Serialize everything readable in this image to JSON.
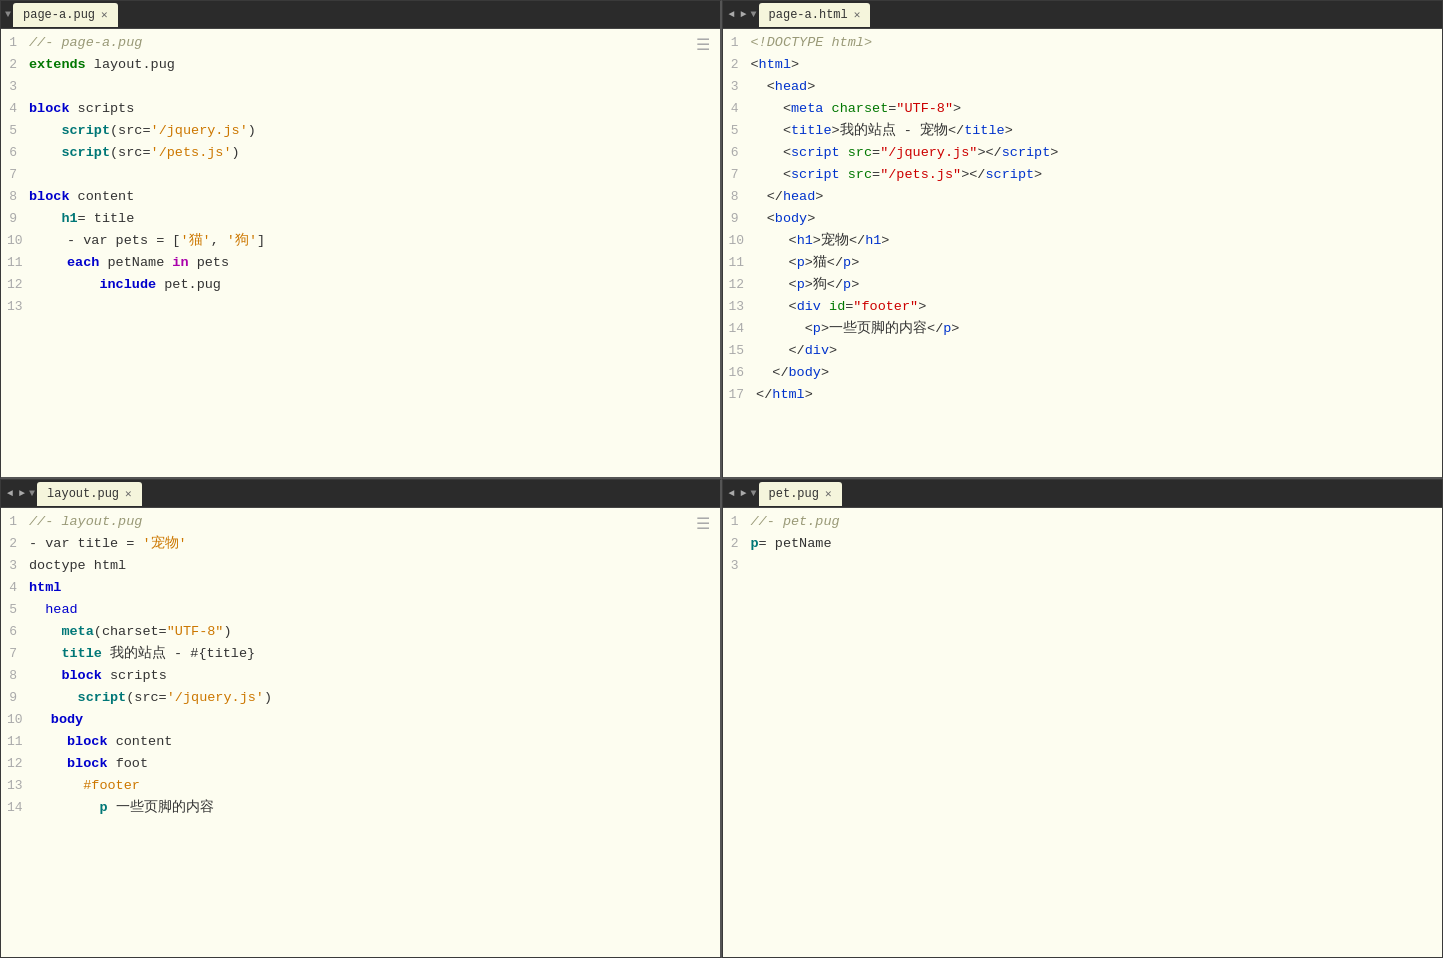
{
  "panes": {
    "top_left": {
      "tab_label": "page-a.pug",
      "lines": [
        {
          "num": 1,
          "tokens": [
            {
              "t": "//- page-a.pug",
              "c": "comment"
            }
          ]
        },
        {
          "num": 2,
          "tokens": [
            {
              "t": "extends",
              "c": "kw-green-bold"
            },
            {
              "t": " layout.pug",
              "c": "plain"
            }
          ]
        },
        {
          "num": 3,
          "tokens": []
        },
        {
          "num": 4,
          "tokens": [
            {
              "t": "block",
              "c": "kw-blue"
            },
            {
              "t": " scripts",
              "c": "plain"
            }
          ]
        },
        {
          "num": 5,
          "tokens": [
            {
              "t": "    ",
              "c": "plain"
            },
            {
              "t": "script",
              "c": "kw-teal-bold"
            },
            {
              "t": "(src=",
              "c": "plain"
            },
            {
              "t": "'/jquery.js'",
              "c": "str-orange"
            },
            {
              "t": ")",
              "c": "plain"
            }
          ]
        },
        {
          "num": 6,
          "tokens": [
            {
              "t": "    ",
              "c": "plain"
            },
            {
              "t": "script",
              "c": "kw-teal-bold"
            },
            {
              "t": "(src=",
              "c": "plain"
            },
            {
              "t": "'/pets.js'",
              "c": "str-orange"
            },
            {
              "t": ")",
              "c": "plain"
            }
          ]
        },
        {
          "num": 7,
          "tokens": []
        },
        {
          "num": 8,
          "tokens": [
            {
              "t": "block",
              "c": "kw-blue"
            },
            {
              "t": " content",
              "c": "plain"
            }
          ]
        },
        {
          "num": 9,
          "tokens": [
            {
              "t": "    ",
              "c": "plain"
            },
            {
              "t": "h1",
              "c": "kw-teal-bold"
            },
            {
              "t": "= title",
              "c": "plain"
            }
          ]
        },
        {
          "num": 10,
          "tokens": [
            {
              "t": "    ",
              "c": "plain"
            },
            {
              "t": "- var pets = [",
              "c": "plain"
            },
            {
              "t": "'猫'",
              "c": "str-orange"
            },
            {
              "t": ", ",
              "c": "plain"
            },
            {
              "t": "'狗'",
              "c": "str-orange"
            },
            {
              "t": "]",
              "c": "plain"
            }
          ]
        },
        {
          "num": 11,
          "tokens": [
            {
              "t": "    ",
              "c": "plain"
            },
            {
              "t": "each",
              "c": "kw-blue"
            },
            {
              "t": " petName ",
              "c": "plain"
            },
            {
              "t": "in",
              "c": "in-kw"
            },
            {
              "t": " pets",
              "c": "plain"
            }
          ]
        },
        {
          "num": 12,
          "tokens": [
            {
              "t": "        ",
              "c": "plain"
            },
            {
              "t": "include",
              "c": "kw-blue"
            },
            {
              "t": " pet.pug",
              "c": "plain"
            }
          ]
        },
        {
          "num": 13,
          "tokens": []
        }
      ]
    },
    "top_right": {
      "tab_label": "page-a.html",
      "lines": [
        {
          "num": 1,
          "tokens": [
            {
              "t": "<!DOCTYPE html>",
              "c": "comment"
            }
          ]
        },
        {
          "num": 2,
          "tokens": [
            {
              "t": "<",
              "c": "plain"
            },
            {
              "t": "html",
              "c": "tag-blue"
            },
            {
              "t": ">",
              "c": "plain"
            }
          ]
        },
        {
          "num": 3,
          "tokens": [
            {
              "t": "  <",
              "c": "plain"
            },
            {
              "t": "head",
              "c": "tag-blue"
            },
            {
              "t": ">",
              "c": "plain"
            }
          ]
        },
        {
          "num": 4,
          "tokens": [
            {
              "t": "    <",
              "c": "plain"
            },
            {
              "t": "meta",
              "c": "tag-blue"
            },
            {
              "t": " ",
              "c": "plain"
            },
            {
              "t": "charset",
              "c": "attr-green"
            },
            {
              "t": "=",
              "c": "plain"
            },
            {
              "t": "\"UTF-8\"",
              "c": "attr-val"
            },
            {
              "t": ">",
              "c": "plain"
            }
          ]
        },
        {
          "num": 5,
          "tokens": [
            {
              "t": "    <",
              "c": "plain"
            },
            {
              "t": "title",
              "c": "tag-blue"
            },
            {
              "t": ">我的站点 - 宠物</",
              "c": "plain"
            },
            {
              "t": "title",
              "c": "tag-blue"
            },
            {
              "t": ">",
              "c": "plain"
            }
          ]
        },
        {
          "num": 6,
          "tokens": [
            {
              "t": "    <",
              "c": "plain"
            },
            {
              "t": "script",
              "c": "tag-blue"
            },
            {
              "t": " ",
              "c": "plain"
            },
            {
              "t": "src",
              "c": "attr-green"
            },
            {
              "t": "=",
              "c": "plain"
            },
            {
              "t": "\"/jquery.js\"",
              "c": "attr-val"
            },
            {
              "t": "></",
              "c": "plain"
            },
            {
              "t": "script",
              "c": "tag-blue"
            },
            {
              "t": ">",
              "c": "plain"
            }
          ]
        },
        {
          "num": 7,
          "tokens": [
            {
              "t": "    <",
              "c": "plain"
            },
            {
              "t": "script",
              "c": "tag-blue"
            },
            {
              "t": " ",
              "c": "plain"
            },
            {
              "t": "src",
              "c": "attr-green"
            },
            {
              "t": "=",
              "c": "plain"
            },
            {
              "t": "\"/pets.js\"",
              "c": "attr-val"
            },
            {
              "t": "></",
              "c": "plain"
            },
            {
              "t": "script",
              "c": "tag-blue"
            },
            {
              "t": ">",
              "c": "plain"
            }
          ]
        },
        {
          "num": 8,
          "tokens": [
            {
              "t": "  </",
              "c": "plain"
            },
            {
              "t": "head",
              "c": "tag-blue"
            },
            {
              "t": ">",
              "c": "plain"
            }
          ]
        },
        {
          "num": 9,
          "tokens": [
            {
              "t": "  <",
              "c": "plain"
            },
            {
              "t": "body",
              "c": "tag-blue"
            },
            {
              "t": ">",
              "c": "plain"
            }
          ]
        },
        {
          "num": 10,
          "tokens": [
            {
              "t": "    <",
              "c": "plain"
            },
            {
              "t": "h1",
              "c": "tag-blue"
            },
            {
              "t": ">宠物</",
              "c": "plain"
            },
            {
              "t": "h1",
              "c": "tag-blue"
            },
            {
              "t": ">",
              "c": "plain"
            }
          ]
        },
        {
          "num": 11,
          "tokens": [
            {
              "t": "    <",
              "c": "plain"
            },
            {
              "t": "p",
              "c": "tag-blue"
            },
            {
              "t": ">猫</",
              "c": "plain"
            },
            {
              "t": "p",
              "c": "tag-blue"
            },
            {
              "t": ">",
              "c": "plain"
            }
          ]
        },
        {
          "num": 12,
          "tokens": [
            {
              "t": "    <",
              "c": "plain"
            },
            {
              "t": "p",
              "c": "tag-blue"
            },
            {
              "t": ">狗</",
              "c": "plain"
            },
            {
              "t": "p",
              "c": "tag-blue"
            },
            {
              "t": ">",
              "c": "plain"
            }
          ]
        },
        {
          "num": 13,
          "tokens": [
            {
              "t": "    <",
              "c": "plain"
            },
            {
              "t": "div",
              "c": "tag-blue"
            },
            {
              "t": " ",
              "c": "plain"
            },
            {
              "t": "id",
              "c": "attr-green"
            },
            {
              "t": "=",
              "c": "plain"
            },
            {
              "t": "\"footer\"",
              "c": "attr-val"
            },
            {
              "t": ">",
              "c": "plain"
            }
          ]
        },
        {
          "num": 14,
          "tokens": [
            {
              "t": "      <",
              "c": "plain"
            },
            {
              "t": "p",
              "c": "tag-blue"
            },
            {
              "t": ">一些页脚的内容</",
              "c": "plain"
            },
            {
              "t": "p",
              "c": "tag-blue"
            },
            {
              "t": ">",
              "c": "plain"
            }
          ]
        },
        {
          "num": 15,
          "tokens": [
            {
              "t": "    </",
              "c": "plain"
            },
            {
              "t": "div",
              "c": "tag-blue"
            },
            {
              "t": ">",
              "c": "plain"
            }
          ]
        },
        {
          "num": 16,
          "tokens": [
            {
              "t": "  </",
              "c": "plain"
            },
            {
              "t": "body",
              "c": "tag-blue"
            },
            {
              "t": ">",
              "c": "plain"
            }
          ]
        },
        {
          "num": 17,
          "tokens": [
            {
              "t": "</",
              "c": "plain"
            },
            {
              "t": "html",
              "c": "tag-blue"
            },
            {
              "t": ">",
              "c": "plain"
            }
          ]
        }
      ]
    },
    "bottom_left": {
      "tab_label": "layout.pug",
      "lines": [
        {
          "num": 1,
          "tokens": [
            {
              "t": "//- layout.pug",
              "c": "comment"
            }
          ]
        },
        {
          "num": 2,
          "tokens": [
            {
              "t": "- var title = ",
              "c": "plain"
            },
            {
              "t": "'宠物'",
              "c": "str-orange"
            }
          ]
        },
        {
          "num": 3,
          "tokens": [
            {
              "t": "doctype html",
              "c": "plain"
            }
          ]
        },
        {
          "num": 4,
          "tokens": [
            {
              "t": "html",
              "c": "kw-blue"
            }
          ]
        },
        {
          "num": 5,
          "tokens": [
            {
              "t": "  ",
              "c": "plain"
            },
            {
              "t": "head",
              "c": "head-kw"
            }
          ]
        },
        {
          "num": 6,
          "tokens": [
            {
              "t": "    ",
              "c": "plain"
            },
            {
              "t": "meta",
              "c": "kw-teal-bold"
            },
            {
              "t": "(charset=",
              "c": "plain"
            },
            {
              "t": "\"UTF-8\"",
              "c": "str-orange"
            },
            {
              "t": ")",
              "c": "plain"
            }
          ]
        },
        {
          "num": 7,
          "tokens": [
            {
              "t": "    ",
              "c": "plain"
            },
            {
              "t": "title",
              "c": "kw-teal-bold"
            },
            {
              "t": " 我的站点 - #{title}",
              "c": "plain"
            }
          ]
        },
        {
          "num": 8,
          "tokens": [
            {
              "t": "    ",
              "c": "plain"
            },
            {
              "t": "block",
              "c": "kw-blue"
            },
            {
              "t": " scripts",
              "c": "plain"
            }
          ]
        },
        {
          "num": 9,
          "tokens": [
            {
              "t": "      ",
              "c": "plain"
            },
            {
              "t": "script",
              "c": "kw-teal-bold"
            },
            {
              "t": "(src=",
              "c": "plain"
            },
            {
              "t": "'/jquery.js'",
              "c": "str-orange"
            },
            {
              "t": ")",
              "c": "plain"
            }
          ]
        },
        {
          "num": 10,
          "tokens": [
            {
              "t": "  ",
              "c": "plain"
            },
            {
              "t": "body",
              "c": "body-kw"
            }
          ]
        },
        {
          "num": 11,
          "tokens": [
            {
              "t": "    ",
              "c": "plain"
            },
            {
              "t": "block",
              "c": "kw-blue"
            },
            {
              "t": " content",
              "c": "plain"
            }
          ]
        },
        {
          "num": 12,
          "tokens": [
            {
              "t": "    ",
              "c": "plain"
            },
            {
              "t": "block",
              "c": "kw-blue"
            },
            {
              "t": " foot",
              "c": "plain"
            }
          ]
        },
        {
          "num": 13,
          "tokens": [
            {
              "t": "      ",
              "c": "plain"
            },
            {
              "t": "#footer",
              "c": "str-orange"
            }
          ]
        },
        {
          "num": 14,
          "tokens": [
            {
              "t": "        ",
              "c": "plain"
            },
            {
              "t": "p",
              "c": "kw-teal-bold"
            },
            {
              "t": " 一些页脚的内容",
              "c": "plain"
            }
          ]
        }
      ]
    },
    "bottom_right": {
      "tab_label": "pet.pug",
      "lines": [
        {
          "num": 1,
          "tokens": [
            {
              "t": "//- pet.pug",
              "c": "comment"
            }
          ]
        },
        {
          "num": 2,
          "tokens": [
            {
              "t": "p",
              "c": "kw-teal-bold"
            },
            {
              "t": "= petName",
              "c": "plain"
            }
          ]
        },
        {
          "num": 3,
          "tokens": []
        }
      ]
    }
  },
  "ui": {
    "nav_left": "◄",
    "nav_right": "►",
    "nav_down": "▼",
    "close_icon": "✕",
    "toolbar_icon": "☰"
  }
}
